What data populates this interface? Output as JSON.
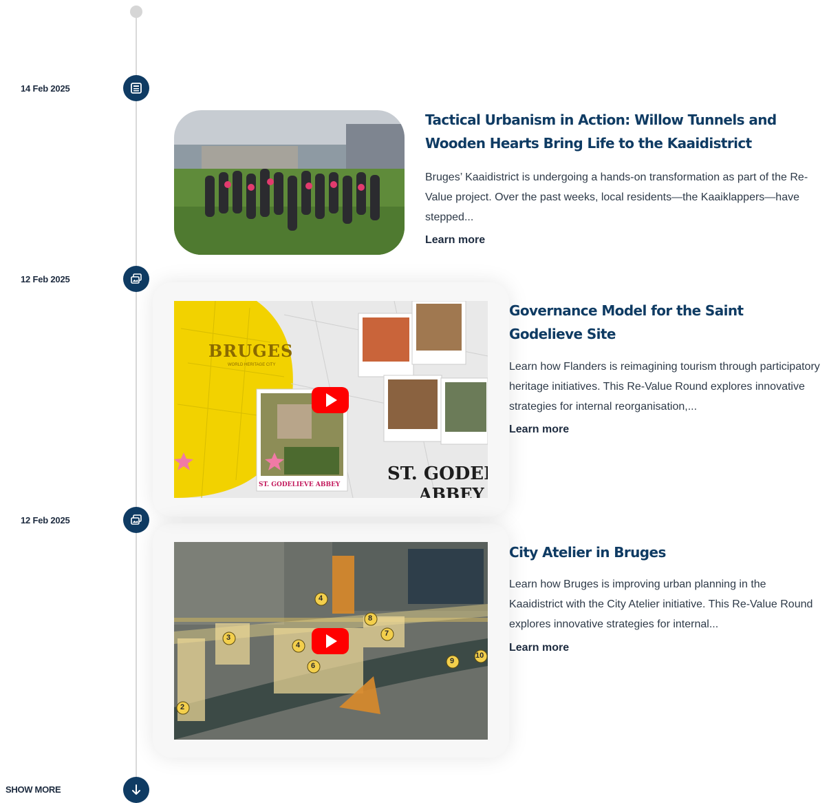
{
  "timeline": {
    "items": [
      {
        "date": "14 Feb 2025",
        "type_icon": "news-icon",
        "title": "Tactical Urbanism in Action: Willow Tunnels and Wooden Hearts Bring Life to the Kaaidistrict",
        "excerpt": "Bruges’ Kaaidistrict is undergoing a hands-on transformation as part of the Re-Value project. Over the past weeks, local residents—the Kaaiklappers—have stepped...",
        "link_label": "Learn more"
      },
      {
        "date": "12 Feb 2025",
        "type_icon": "media-gallery-icon",
        "title": "Governance Model for the Saint Godelieve Site",
        "excerpt": "Learn how Flanders is reimagining tourism through participatory heritage initiatives. This Re-Value Round explores innovative strategies for internal reorganisation,...",
        "link_label": "Learn more",
        "video_text": {
          "city": "BRUGES",
          "city_sub": "WORLD HERITAGE CITY",
          "abbey_label": "ST. GODELIEVE ABBEY",
          "big_caption": "ST. GODELIEV",
          "big_caption2": "ABBEY"
        }
      },
      {
        "date": "12 Feb 2025",
        "type_icon": "media-gallery-icon",
        "title": "City Atelier in Bruges",
        "excerpt": "Learn how Bruges is improving urban planning in the Kaaidistrict with the City Atelier initiative. This Re-Value Round explores innovative strategies for internal...",
        "link_label": "Learn more",
        "map_numbers": [
          "2",
          "3",
          "4",
          "4",
          "6",
          "7",
          "8",
          "9",
          "10"
        ]
      }
    ]
  },
  "show_more_label": "SHOW MORE",
  "colors": {
    "accent": "#0f3b63",
    "line": "#d9d9d9",
    "play": "#ff0000"
  }
}
